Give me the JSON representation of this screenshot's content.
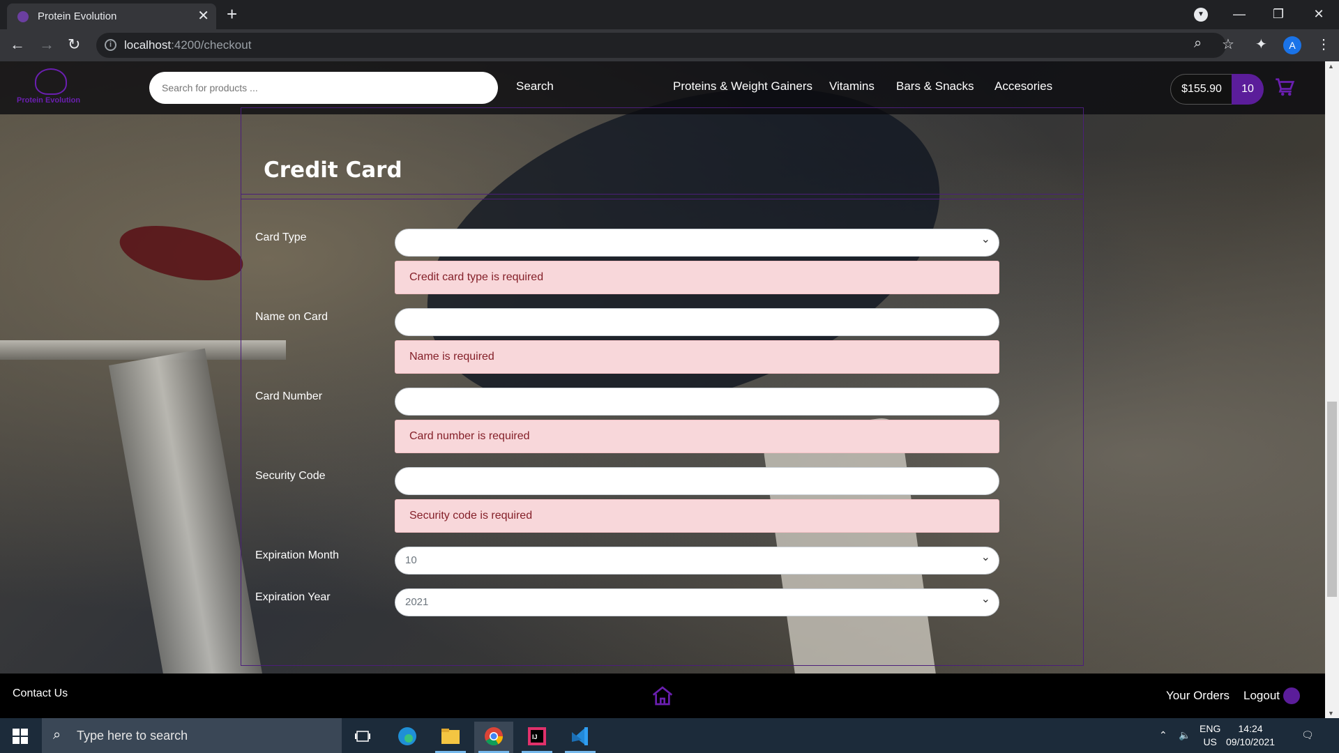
{
  "browser": {
    "tab_title": "Protein Evolution",
    "tab_close": "✕",
    "new_tab": "+",
    "url_host": "localhost",
    "url_path": ":4200/checkout"
  },
  "header": {
    "logo_text": "Protein Evolution",
    "search_placeholder": "Search for products ...",
    "search_button": "Search",
    "nav": [
      "Proteins & Weight Gainers",
      "Vitamins",
      "Bars & Snacks",
      "Accesories"
    ],
    "cart_total": "$155.90",
    "cart_count": "10"
  },
  "form": {
    "title": "Credit Card",
    "fields": {
      "card_type": {
        "label": "Card Type",
        "value": "",
        "error": "Credit card type is required"
      },
      "name_on_card": {
        "label": "Name on Card",
        "value": "",
        "error": "Name is required"
      },
      "card_number": {
        "label": "Card Number",
        "value": "",
        "error": "Card number is required"
      },
      "security_code": {
        "label": "Security Code",
        "value": "",
        "error": "Security code is required"
      },
      "expiration_month": {
        "label": "Expiration Month",
        "value": "10"
      },
      "expiration_year": {
        "label": "Expiration Year",
        "value": "2021"
      }
    }
  },
  "footer": {
    "contact": "Contact Us",
    "orders": "Your Orders",
    "logout": "Logout"
  },
  "taskbar": {
    "search_text": "Type here to search",
    "lang_1": "ENG",
    "lang_2": "US",
    "time": "14:24",
    "date": "09/10/2021"
  },
  "colors": {
    "brand_purple": "#5b1d9a",
    "error_bg": "#f8d7da",
    "error_text": "#842029"
  }
}
